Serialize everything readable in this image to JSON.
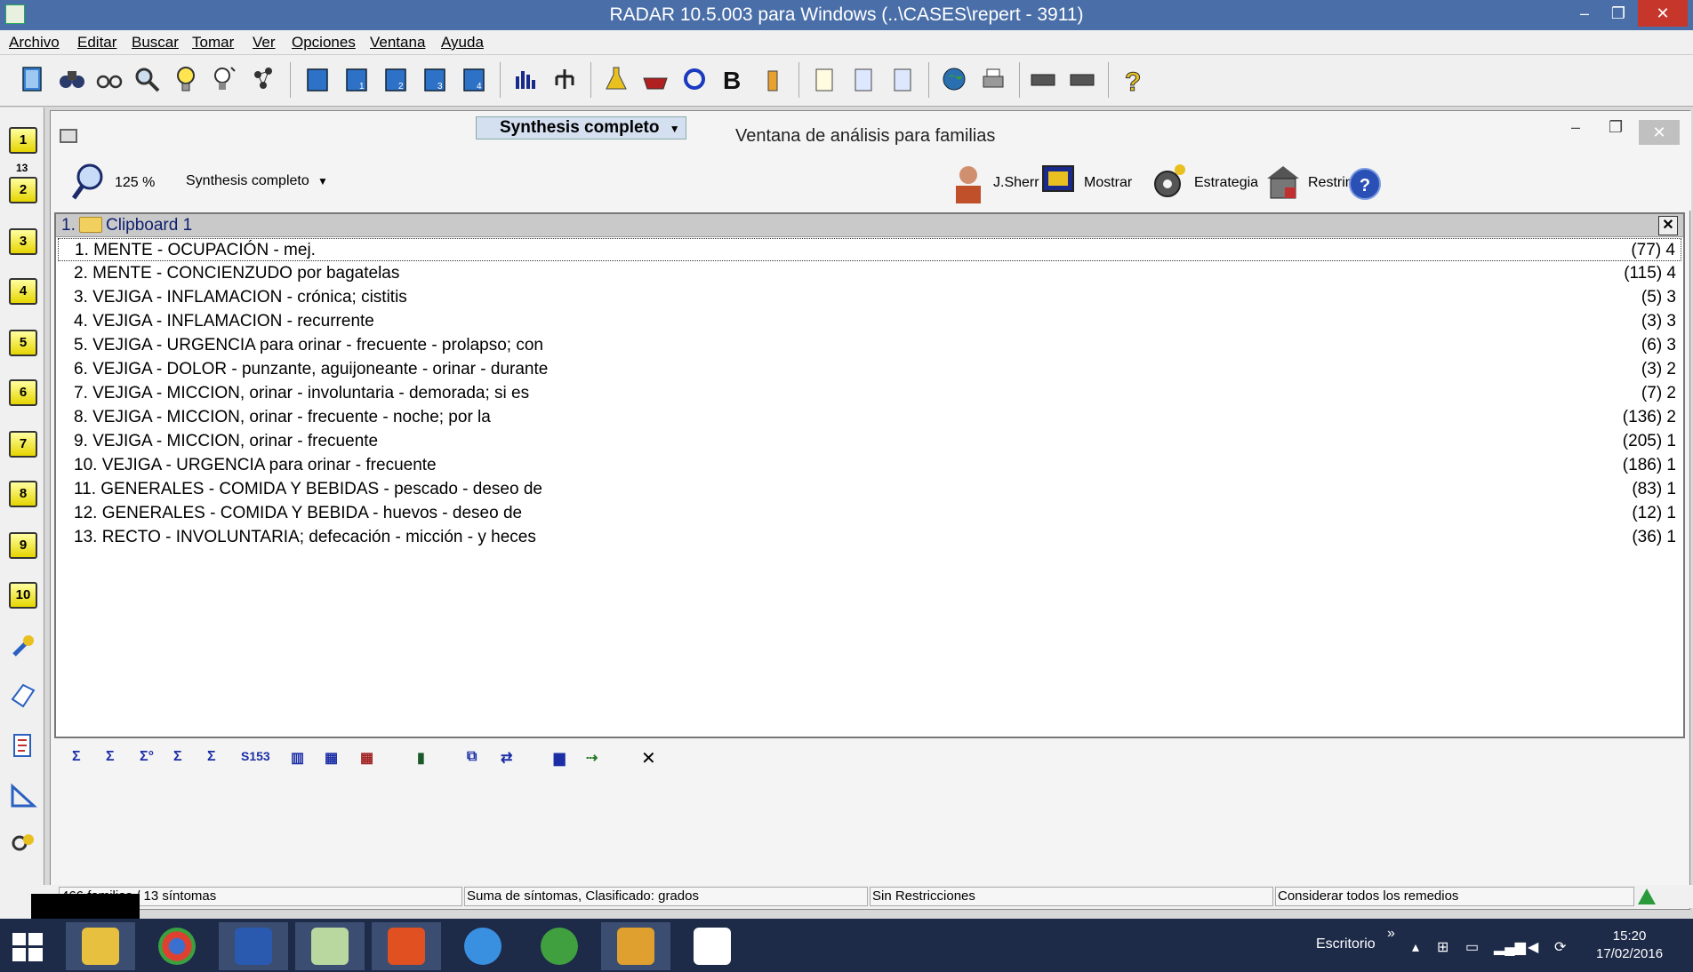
{
  "window": {
    "title": "RADAR 10.5.003 para Windows (..\\CASES\\repert - 3911)",
    "minimize": "–",
    "restore": "❐",
    "close": "✕"
  },
  "menu": [
    "Archivo",
    "Editar",
    "Buscar",
    "Tomar",
    "Ver",
    "Opciones",
    "Ventana",
    "Ayuda"
  ],
  "sidebar": {
    "clip_count": "13",
    "clipboards": [
      "1",
      "2",
      "3",
      "4",
      "5",
      "6",
      "7",
      "8",
      "9",
      "10"
    ]
  },
  "analysis_window": {
    "title": "Ventana de análisis para familias",
    "tab_dropdown": "Synthesis completo",
    "zoom": "125 %",
    "mode": "Synthesis completo",
    "buttons": {
      "jsherr": "J.Sherr",
      "mostrar": "Mostrar",
      "estrategia": "Estrategia",
      "restringir": "Restringir a"
    },
    "help": "?"
  },
  "clipboard": {
    "number": "1.",
    "name": "Clipboard 1",
    "close": "✕",
    "rubrics": [
      {
        "text": "1. MENTE - OCUPACIÓN - mej.",
        "value": "(77) 4"
      },
      {
        "text": "2. MENTE - CONCIENZUDO por bagatelas",
        "value": "(115) 4"
      },
      {
        "text": "3. VEJIGA - INFLAMACION - crónica; cistitis",
        "value": "(5) 3"
      },
      {
        "text": "4. VEJIGA - INFLAMACION - recurrente",
        "value": "(3) 3"
      },
      {
        "text": "5. VEJIGA - URGENCIA para orinar - frecuente - prolapso; con",
        "value": "(6) 3"
      },
      {
        "text": "6. VEJIGA - DOLOR - punzante, aguijoneante - orinar - durante",
        "value": "(3) 2"
      },
      {
        "text": "7. VEJIGA - MICCION, orinar - involuntaria - demorada; si es",
        "value": "(7) 2"
      },
      {
        "text": "8. VEJIGA - MICCION, orinar - frecuente - noche; por la",
        "value": "(136) 2"
      },
      {
        "text": "9. VEJIGA - MICCION, orinar - frecuente",
        "value": "(205) 1"
      },
      {
        "text": "10. VEJIGA - URGENCIA para orinar - frecuente",
        "value": "(186) 1"
      },
      {
        "text": "11. GENERALES - COMIDA Y BEBIDAS - pescado - deseo de",
        "value": "(83) 1"
      },
      {
        "text": "12. GENERALES - COMIDA Y BEBIDA - huevos - deseo de",
        "value": "(12) 1"
      },
      {
        "text": "13. RECTO - INVOLUNTARIA; defecación - micción - y heces",
        "value": "(36) 1"
      }
    ]
  },
  "bottom_tools": {
    "sigma1": "Σ",
    "sigma2": "Σ",
    "sigma3": "Σ°",
    "sigma4": "Σ",
    "sigma5": "Σ",
    "s153": "S153",
    "close": "✕"
  },
  "statusbar": {
    "families": "466 familias / 13 síntomas",
    "sum": "Suma de síntomas, Clasificado: grados",
    "restrictions": "Sin Restricciones",
    "remedies": "Considerar todos los remedios"
  },
  "taskbar": {
    "escritorio": "Escritorio",
    "expand": "»",
    "time": "15:20",
    "date": "17/02/2016"
  }
}
